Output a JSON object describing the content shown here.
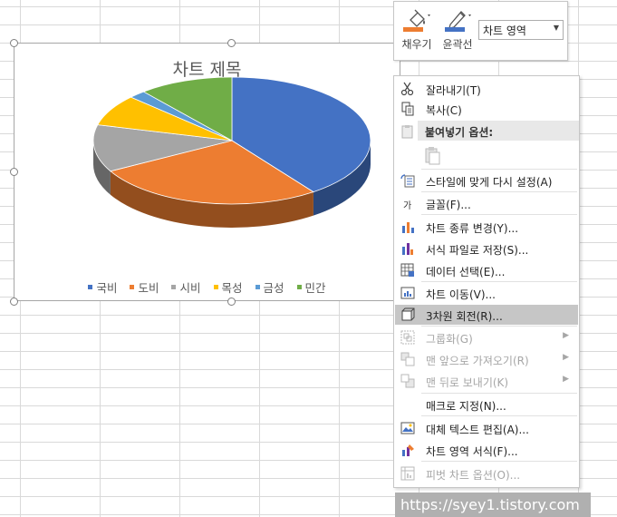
{
  "chart": {
    "title": "차트 제목",
    "legend": [
      {
        "name": "국비",
        "color": "#4472c4"
      },
      {
        "name": "도비",
        "color": "#ed7d31"
      },
      {
        "name": "시비",
        "color": "#a5a5a5"
      },
      {
        "name": "목성",
        "color": "#ffc000"
      },
      {
        "name": "금성",
        "color": "#5b9bd5"
      },
      {
        "name": "민간",
        "color": "#70ad47"
      }
    ]
  },
  "chart_data": {
    "type": "pie",
    "variant": "3d-pie",
    "title": "차트 제목",
    "categories": [
      "국비",
      "도비",
      "시비",
      "목성",
      "금성",
      "민간"
    ],
    "values": [
      40,
      27,
      12,
      8,
      2,
      11
    ],
    "colors": [
      "#4472c4",
      "#ed7d31",
      "#a5a5a5",
      "#ffc000",
      "#5b9bd5",
      "#70ad47"
    ],
    "legend_position": "bottom"
  },
  "mini_toolbar": {
    "fill_label": "채우기",
    "outline_label": "윤곽선",
    "chart_element_value": "차트 영역",
    "fill_color": "#ed7d31",
    "outline_color": "#4472c4"
  },
  "context_menu": {
    "items": [
      {
        "label": "잘라내기(T)",
        "icon": "scissors-icon"
      },
      {
        "label": "복사(C)",
        "icon": "copy-icon"
      },
      {
        "label": "붙여넣기 옵션:",
        "icon": "paste-icon"
      },
      {
        "label": "스타일에 맞게 다시 설정(A)",
        "icon": "reset-style-icon"
      },
      {
        "label": "글꼴(F)...",
        "icon": "font-icon"
      },
      {
        "label": "차트 종류 변경(Y)...",
        "icon": "chart-type-icon"
      },
      {
        "label": "서식 파일로 저장(S)...",
        "icon": "save-template-icon"
      },
      {
        "label": "데이터 선택(E)...",
        "icon": "select-data-icon"
      },
      {
        "label": "차트 이동(V)...",
        "icon": "move-chart-icon"
      },
      {
        "label": "3차원 회전(R)...",
        "icon": "3d-rotation-icon"
      },
      {
        "label": "그룹화(G)",
        "icon": "group-icon"
      },
      {
        "label": "맨 앞으로 가져오기(R)",
        "icon": "bring-front-icon"
      },
      {
        "label": "맨 뒤로 보내기(K)",
        "icon": "send-back-icon"
      },
      {
        "label": "매크로 지정(N)...",
        "icon": ""
      },
      {
        "label": "대체 텍스트 편집(A)...",
        "icon": "alt-text-icon"
      },
      {
        "label": "차트 영역 서식(F)...",
        "icon": "format-chart-icon"
      },
      {
        "label": "피벗 차트 옵션(O)...",
        "icon": "pivot-options-icon"
      }
    ],
    "font_icon_glyph": "가",
    "submenu_arrow": "▶"
  },
  "watermark": "https://syey1.tistory.com"
}
